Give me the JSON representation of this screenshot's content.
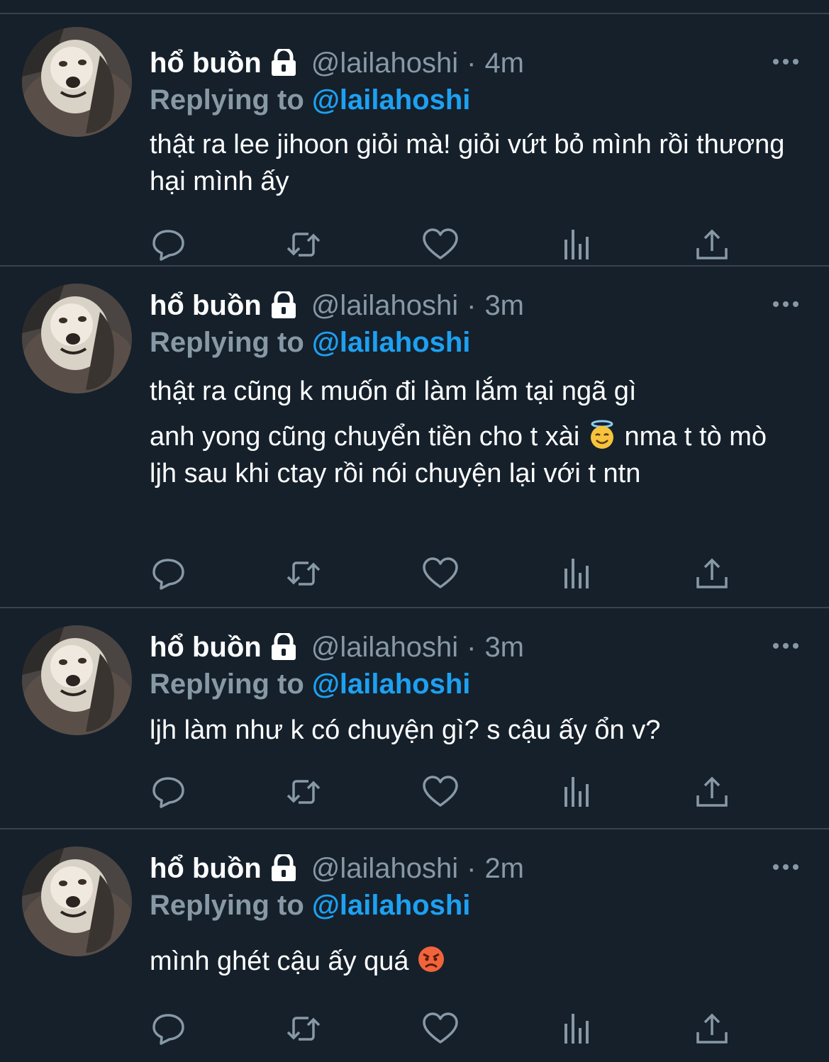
{
  "tweets": [
    {
      "name": "hổ buồn",
      "handle": "@lailahoshi",
      "separator": "·",
      "time": "4m",
      "replying_label": "Replying to ",
      "replying_to": "@lailahoshi",
      "lines": [
        "thật ra lee jihoon giỏi mà! giỏi vứt bỏ mình rồi thương hại mình ấy"
      ]
    },
    {
      "name": "hổ buồn",
      "handle": "@lailahoshi",
      "separator": "·",
      "time": "3m",
      "replying_label": "Replying to ",
      "replying_to": "@lailahoshi",
      "lines": [
        "thật ra cũng k muốn đi làm lắm tại ngã gì",
        "anh yong cũng chuyển tiền cho t xài",
        "nma t tò mò ljh sau khi ctay rồi nói chuyện lại với t ntn"
      ],
      "emoji": "smiling-face-with-halo-icon"
    },
    {
      "name": "hổ buồn",
      "handle": "@lailahoshi",
      "separator": "·",
      "time": "3m",
      "replying_label": "Replying to ",
      "replying_to": "@lailahoshi",
      "lines": [
        "ljh làm như k có chuyện gì? s cậu ấy ổn v?"
      ]
    },
    {
      "name": "hổ buồn",
      "handle": "@lailahoshi",
      "separator": "·",
      "time": "2m",
      "replying_label": "Replying to ",
      "replying_to": "@lailahoshi",
      "lines": [
        "mình ghét cậu ấy quá"
      ],
      "emoji": "angry-face-icon"
    }
  ],
  "colors": {
    "background": "#15202b",
    "divider": "#38444d",
    "muted": "#8899a6",
    "accent": "#1da1f2",
    "text": "#ffffff"
  },
  "icons": {
    "protected": "lock-icon",
    "more": "more-icon",
    "reply": "reply-icon",
    "retweet": "retweet-icon",
    "like": "heart-icon",
    "analytics": "analytics-icon",
    "share": "share-icon"
  }
}
